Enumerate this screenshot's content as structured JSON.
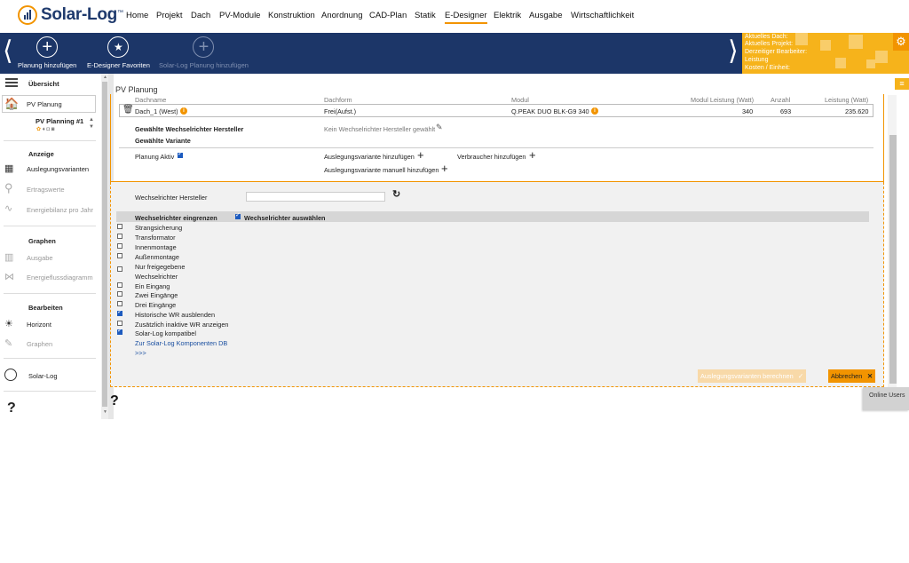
{
  "nav": {
    "logo": "Solar-Log",
    "logo_tm": "™",
    "items": [
      "Home",
      "Projekt",
      "Dach",
      "PV-Module",
      "Konstruktion",
      "Anordnung",
      "CAD-Plan",
      "Statik",
      "E-Designer",
      "Elektrik",
      "Ausgabe",
      "Wirtschaftlichkeit"
    ],
    "active": "E-Designer",
    "accent_color": "#f29400"
  },
  "toolbar": {
    "prev": "⟨",
    "next": "⟩",
    "add_plan": "Planung hinzufügen",
    "favorites": "E-Designer Favoriten",
    "add_solarlog": "Solar-Log Planung hinzufügen",
    "bg_color": "#1c3668"
  },
  "status_panel": {
    "line1": "Aktuelles Dach:",
    "line2": "Aktuelles Projekt:",
    "line3": "Derzeitiger Bearbeiter:",
    "line4": "Leistung",
    "line5": "Kosten / Einheit:",
    "bg_color": "#f6b31b"
  },
  "sidebar": {
    "overview": "Übersicht",
    "pv_planning": "PV Planung",
    "planning_item": "PV Planning #1",
    "section_display": "Anzeige",
    "design_variants": "Auslegungsvarianten",
    "yield_values": "Ertragswerte",
    "energy_balance": "Energiebilanz pro Jahr",
    "section_graphs": "Graphen",
    "output": "Ausgabe",
    "energy_flow": "Energieflussdiagramm",
    "section_edit": "Bearbeiten",
    "horizon": "Horizont",
    "graphs": "Graphen",
    "solarlog": "Solar-Log",
    "help": "?"
  },
  "main": {
    "title": "PV Planung",
    "table_headers": [
      "Dachname",
      "Dachform",
      "Modul",
      "Modul Leistung (Watt)",
      "Anzahl",
      "Leistung (Watt)"
    ],
    "table_row": {
      "roof": "Dach_1 (West)",
      "form": "Frei(Aufst.)",
      "module": "Q.PEAK DUO BLK-G9 340",
      "module_power": "340",
      "count": "693",
      "power": "235.620"
    },
    "chosen_manufacturer_label": "Gewählte Wechselrichter Hersteller",
    "chosen_variant_label": "Gewählte Variante",
    "no_manufacturer": "Kein Wechselrichter Hersteller gewählt",
    "planning_active": "Planung Aktiv",
    "add_variant": "Auslegungsvariante hinzufügen",
    "add_consumer": "Verbraucher hinzufügen",
    "add_variant_manual": "Auslegungsvariante manuell hinzufügen",
    "inverter_manufacturer": "Wechselrichter Hersteller",
    "manufacturer_value": "",
    "limit_inverters": "Wechselrichter eingrenzen",
    "select_inverters": "Wechselrichter auswählen",
    "filters": [
      {
        "label": "Strangsicherung",
        "checked": false
      },
      {
        "label": "Transformator",
        "checked": false
      },
      {
        "label": "Innenmontage",
        "checked": false
      },
      {
        "label": "Außenmontage",
        "checked": false
      },
      {
        "label": "Nur freigegebene",
        "checked": false
      },
      {
        "label": "Wechselrichter",
        "checked": false
      },
      {
        "label": "Ein Eingang",
        "checked": false
      },
      {
        "label": "Zwei Eingänge",
        "checked": false
      },
      {
        "label": "Drei Eingänge",
        "checked": false
      },
      {
        "label": "Historische WR ausblenden",
        "checked": true
      },
      {
        "label": "Zusätzlich inaktive WR anzeigen",
        "checked": false
      },
      {
        "label": "Solar-Log kompatibel",
        "checked": true
      }
    ],
    "components_link": "Zur Solar-Log Komponenten DB",
    "more": ">>>",
    "calc_button": "Auslegungsvarianten berechnen",
    "cancel_button": "Abbrechen",
    "help": "?"
  },
  "online_users": "Online Users"
}
